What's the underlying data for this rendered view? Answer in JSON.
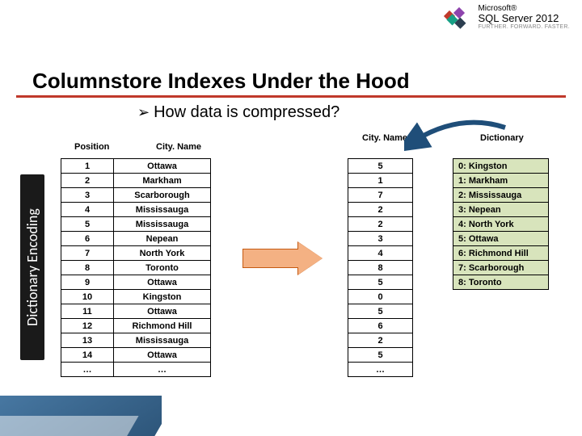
{
  "branding": {
    "top": "Microsoft®",
    "brand": "SQL Server 2012",
    "tag": "FURTHER. FORWARD. FASTER."
  },
  "title": "Columnstore Indexes Under the Hood",
  "subtitle": "How data is compressed?",
  "sideLabel": "Dictionary Encoding",
  "headers": {
    "position": "Position",
    "cityName": "City. Name",
    "dictionary": "Dictionary"
  },
  "sourceTable": [
    {
      "pos": "1",
      "city": "Ottawa"
    },
    {
      "pos": "2",
      "city": "Markham"
    },
    {
      "pos": "3",
      "city": "Scarborough"
    },
    {
      "pos": "4",
      "city": "Mississauga"
    },
    {
      "pos": "5",
      "city": "Mississauga"
    },
    {
      "pos": "6",
      "city": "Nepean"
    },
    {
      "pos": "7",
      "city": "North York"
    },
    {
      "pos": "8",
      "city": "Toronto"
    },
    {
      "pos": "9",
      "city": "Ottawa"
    },
    {
      "pos": "10",
      "city": "Kingston"
    },
    {
      "pos": "11",
      "city": "Ottawa"
    },
    {
      "pos": "12",
      "city": "Richmond Hill"
    },
    {
      "pos": "13",
      "city": "Mississauga"
    },
    {
      "pos": "14",
      "city": "Ottawa"
    },
    {
      "pos": "…",
      "city": "…"
    }
  ],
  "encodedColumn": [
    "5",
    "1",
    "7",
    "2",
    "2",
    "3",
    "4",
    "8",
    "5",
    "0",
    "5",
    "6",
    "2",
    "5",
    "…"
  ],
  "dictionary": [
    "0: Kingston",
    "1: Markham",
    "2: Mississauga",
    "3: Nepean",
    "4: North York",
    "5: Ottawa",
    "6: Richmond Hill",
    "7: Scarborough",
    "8: Toronto"
  ]
}
